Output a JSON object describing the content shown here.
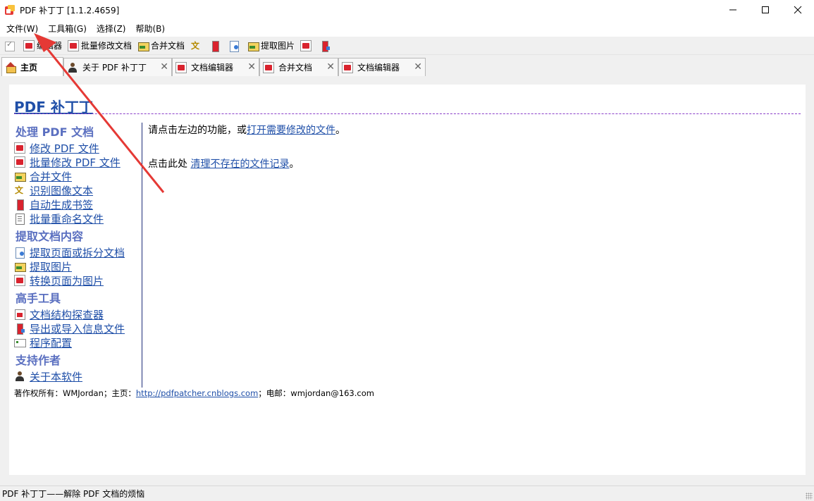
{
  "window": {
    "title": "PDF 补丁丁 [1.1.2.4659]",
    "minimize_glyph": "—",
    "maximize_glyph": "☐",
    "close_glyph": "✕"
  },
  "menu": [
    {
      "label": "文件(W)"
    },
    {
      "label": "工具箱(G)"
    },
    {
      "label": "选择(Z)"
    },
    {
      "label": "帮助(B)"
    }
  ],
  "toolbar": {
    "items": [
      {
        "icon": "checkbox-icon",
        "label": ""
      },
      {
        "icon": "pdf-editor-icon",
        "label": "编辑器"
      },
      {
        "icon": "batch-edit-icon",
        "label": "批量修改文档"
      },
      {
        "icon": "merge-icon",
        "label": "合并文档"
      },
      {
        "icon": "ocr-icon",
        "label": ""
      },
      {
        "icon": "bookmark-icon",
        "label": ""
      },
      {
        "icon": "extract-pages-icon",
        "label": ""
      },
      {
        "icon": "extract-images-icon",
        "label": "提取图片"
      },
      {
        "icon": "convert-icon",
        "label": ""
      },
      {
        "icon": "export-icon",
        "label": ""
      }
    ]
  },
  "tabs": [
    {
      "label": "主页",
      "icon": "home-icon",
      "closable": false,
      "active": true
    },
    {
      "label": "关于 PDF 补丁丁",
      "icon": "person-icon",
      "closable": true,
      "active": false
    },
    {
      "label": "文档编辑器",
      "icon": "pdf-icon",
      "closable": true,
      "active": false
    },
    {
      "label": "合并文档",
      "icon": "merge-icon",
      "closable": true,
      "active": false
    },
    {
      "label": "文档编辑器",
      "icon": "pdf-icon",
      "closable": true,
      "active": false
    }
  ],
  "home": {
    "title": "PDF 补丁丁",
    "sections": [
      {
        "heading": "处理 PDF 文档",
        "links": [
          {
            "label": "修改 PDF 文件",
            "icon": "pdf-edit-icon"
          },
          {
            "label": "批量修改 PDF 文件",
            "icon": "batch-pdf-icon"
          },
          {
            "label": "合并文件",
            "icon": "merge-icon"
          },
          {
            "label": "识别图像文本",
            "icon": "ocr-icon"
          },
          {
            "label": "自动生成书签",
            "icon": "bookmark-icon"
          },
          {
            "label": "批量重命名文件",
            "icon": "rename-icon"
          }
        ]
      },
      {
        "heading": "提取文档内容",
        "links": [
          {
            "label": "提取页面或拆分文档",
            "icon": "extract-pages-icon"
          },
          {
            "label": "提取图片",
            "icon": "image-icon"
          },
          {
            "label": "转换页面为图片",
            "icon": "convert-icon"
          }
        ]
      },
      {
        "heading": "高手工具",
        "links": [
          {
            "label": "文档结构探查器",
            "icon": "explorer-icon"
          },
          {
            "label": "导出或导入信息文件",
            "icon": "export-icon"
          },
          {
            "label": "程序配置",
            "icon": "config-icon"
          }
        ]
      },
      {
        "heading": "支持作者",
        "links": [
          {
            "label": "关于本软件",
            "icon": "person-icon"
          }
        ]
      }
    ],
    "prompt_prefix": "请点击左边的功能，或",
    "prompt_link": "打开需要修改的文件",
    "prompt_suffix": "。",
    "cleanup_prefix": "点击此处 ",
    "cleanup_link": "清理不存在的文件记录",
    "cleanup_suffix": "。",
    "copyright_prefix": "著作权所有：WMJordan；主页：",
    "homepage_link": "http://pdfpatcher.cnblogs.com",
    "copyright_suffix": "；电邮：wmjordan@163.com"
  },
  "status": {
    "text": "PDF 补丁丁——解除 PDF 文档的烦恼"
  },
  "colors": {
    "link": "#1f4fa8",
    "heading": "#5a6fc0",
    "arrow": "#e53935"
  }
}
